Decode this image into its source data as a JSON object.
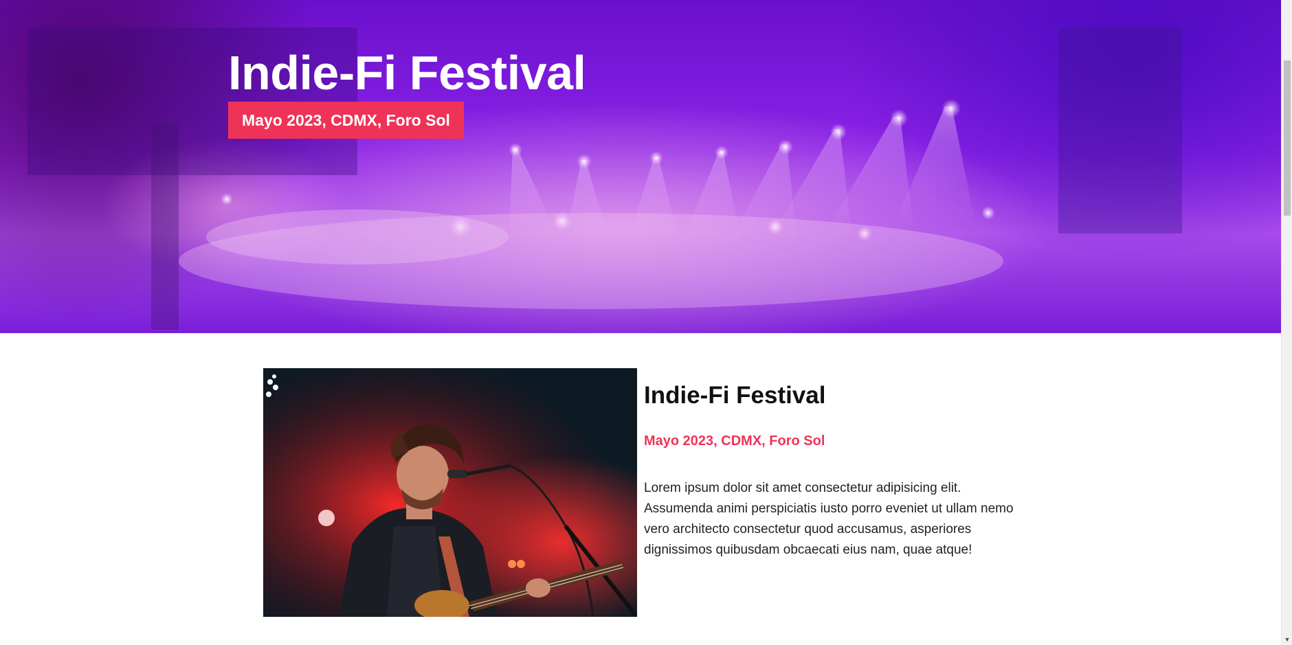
{
  "hero": {
    "title": "Indie-Fi Festival",
    "badge": "Mayo 2023, CDMX, Foro Sol",
    "accent_color": "#ef3358"
  },
  "feature": {
    "title": "Indie-Fi Festival",
    "subtitle": "Mayo 2023, CDMX, Foro Sol",
    "body": "Lorem ipsum dolor sit amet consectetur adipisicing elit. Assumenda animi perspiciatis iusto porro eveniet ut ullam nemo vero architecto consectetur quod accusamus, asperiores dignissimos quibusdam obcaecati eius nam, quae atque!"
  },
  "scrollbar": {
    "down_arrow_icon": "chevron-down-icon"
  }
}
